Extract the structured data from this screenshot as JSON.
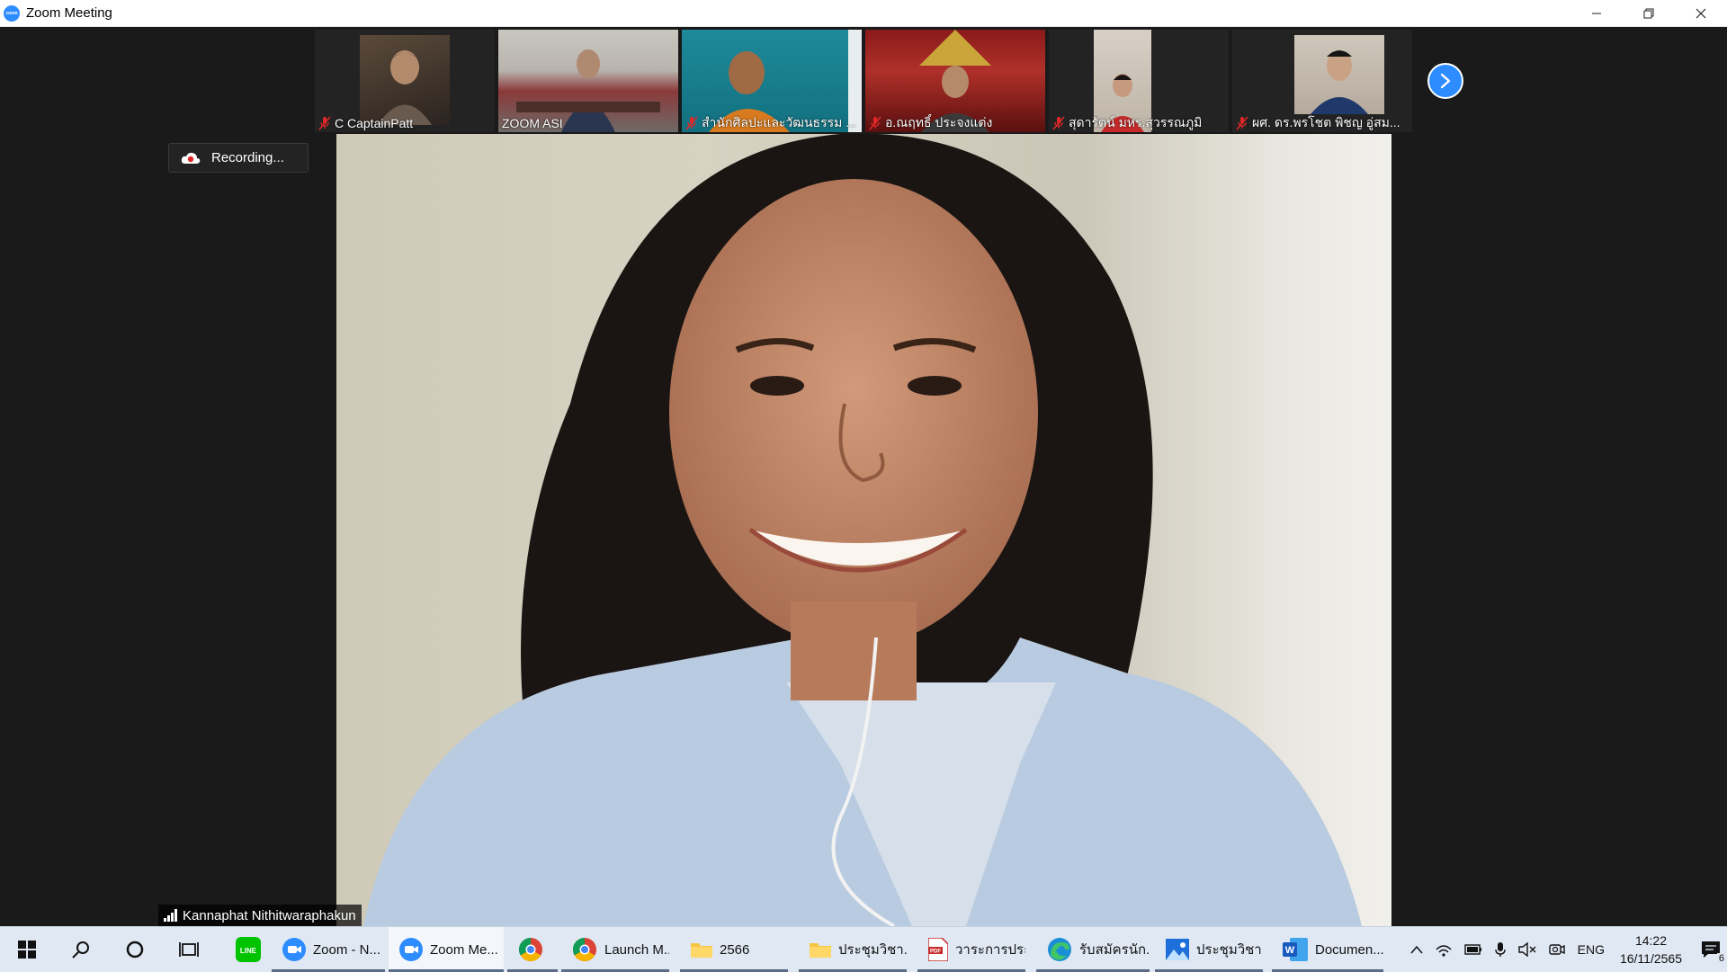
{
  "window": {
    "title": "Zoom Meeting",
    "minimize": "—",
    "restore": "❐",
    "close": "✕"
  },
  "gallery": {
    "participants": [
      {
        "name": "C CaptainPatt",
        "muted": true
      },
      {
        "name": "ZOOM ASI",
        "muted": false
      },
      {
        "name": "สำนักศิลปะและวัฒนธรรม ...",
        "muted": true
      },
      {
        "name": "อ.ณฤทธิ์ ประจงแต่ง",
        "muted": true
      },
      {
        "name": "สุดารัตน์ มหร.สุวรรณภูมิ",
        "muted": true
      },
      {
        "name": "ผศ. ดร.พรโชต พิชญ อู่สม...",
        "muted": true
      }
    ],
    "next_icon": "chevron-right-icon"
  },
  "recording": {
    "label": "Recording..."
  },
  "speaker": {
    "name": "Kannaphat Nithitwaraphakun"
  },
  "taskbar": {
    "apps": [
      {
        "label": "",
        "icon": "line-icon"
      },
      {
        "label": "Zoom - N...",
        "icon": "zoom-icon"
      },
      {
        "label": "Zoom Me...",
        "icon": "zoom-icon",
        "active": true
      },
      {
        "label": "",
        "icon": "chrome-icon"
      },
      {
        "label": "Launch M...",
        "icon": "chrome-icon"
      },
      {
        "label": "2566",
        "icon": "folder-icon"
      },
      {
        "label": "ประชุมวิชา...",
        "icon": "folder-icon"
      },
      {
        "label": "วาระการประ...",
        "icon": "pdf-icon"
      },
      {
        "label": "รับสมัครนัก...",
        "icon": "edge-icon"
      },
      {
        "label": "ประชุมวิชา...",
        "icon": "photos-icon"
      },
      {
        "label": "Documen...",
        "icon": "word-icon"
      }
    ],
    "tray": {
      "language": "ENG",
      "time": "14:22",
      "date": "16/11/2565",
      "notifications": "6"
    }
  },
  "colors": {
    "zoom_blue": "#2d8cff",
    "muted_red": "#e02828",
    "taskbar_bg": "#dfe8f3"
  }
}
